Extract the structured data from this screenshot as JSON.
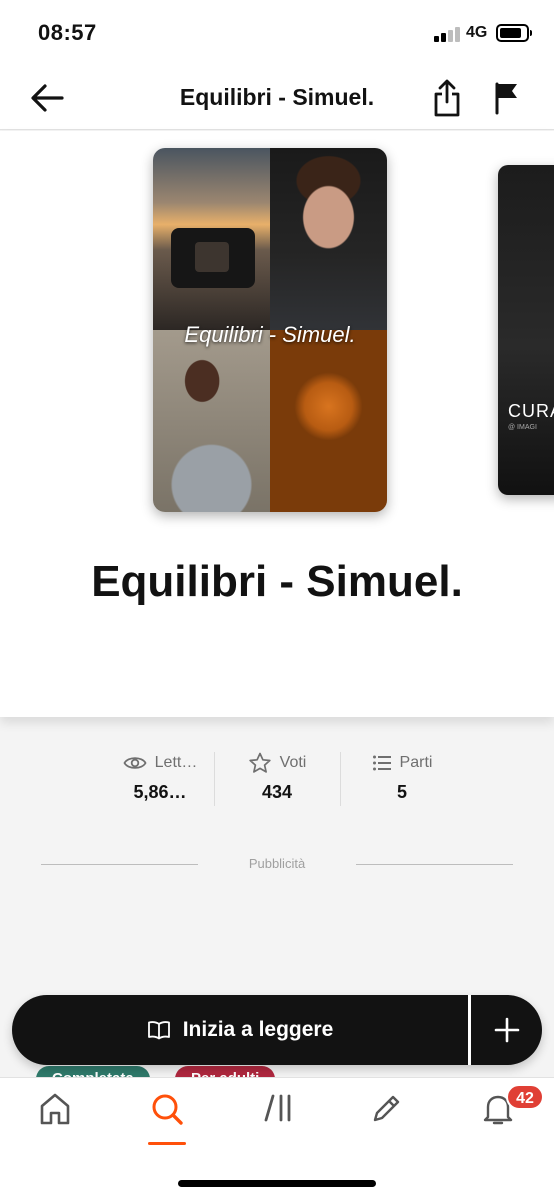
{
  "status_bar": {
    "time": "08:57",
    "network": "4G",
    "battery_level": 0.85
  },
  "nav": {
    "title": "Equilibri - Simuel."
  },
  "hero": {
    "cover_text": "Equilibri - Simuel.",
    "next_cover_text": "CURAF",
    "next_cover_sub": "@ IMAGI",
    "title": "Equilibri - Simuel."
  },
  "stats": [
    {
      "icon": "eye-icon",
      "label": "Lett…",
      "value": "5,86…"
    },
    {
      "icon": "star-icon",
      "label": "Voti",
      "value": "434"
    },
    {
      "icon": "list-icon",
      "label": "Parti",
      "value": "5"
    }
  ],
  "ad": {
    "label": "Pubblicità"
  },
  "tags": [
    "Completata",
    "Per adulti"
  ],
  "read_bar": {
    "read_label": "Inizia a leggere",
    "read_icon": "open-book-icon",
    "add_icon": "plus-icon"
  },
  "tab_bar": {
    "tabs": [
      "home-icon",
      "search-icon",
      "library-icon",
      "pencil-icon",
      "bell-icon"
    ],
    "active_tab": "search-icon",
    "notification_count": "42"
  },
  "colors": {
    "accent": "#ff500a",
    "dark": "#121212",
    "tag_green": "#2f7a6b",
    "tag_red": "#b0283f",
    "badge": "#e03f35"
  }
}
